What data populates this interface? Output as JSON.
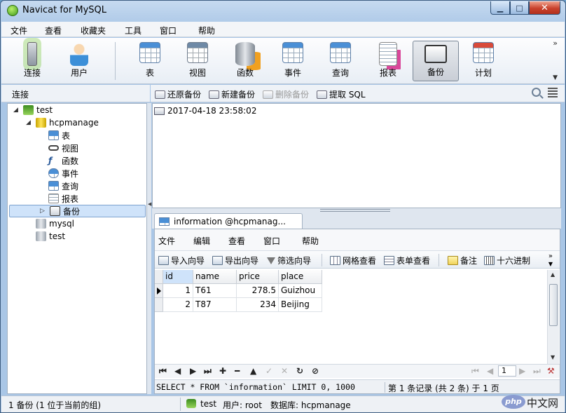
{
  "window": {
    "title": "Navicat for MySQL",
    "min_glyph": "▁",
    "max_glyph": "□",
    "close_glyph": "✕"
  },
  "menu": [
    "文件",
    "查看",
    "收藏夹",
    "工具",
    "窗口",
    "帮助"
  ],
  "toolbar": {
    "buttons": [
      "连接",
      "用户",
      "表",
      "视图",
      "函数",
      "事件",
      "查询",
      "报表",
      "备份",
      "计划"
    ],
    "active": "备份",
    "overflow_glyph": "»",
    "down_glyph": "▼"
  },
  "connection_header": "连接",
  "object_toolbar": {
    "restore": "还原备份",
    "new": "新建备份",
    "delete": "删除备份",
    "extract": "提取 SQL"
  },
  "tree": {
    "root": "test",
    "db_open": "hcpmanage",
    "children": [
      "表",
      "视图",
      "函数",
      "事件",
      "查询",
      "报表",
      "备份"
    ],
    "other_dbs": [
      "mysql",
      "test"
    ],
    "expand_open": "◢",
    "expand_closed": "▷"
  },
  "backup_list": {
    "items": [
      "2017-04-18 23:58:02"
    ]
  },
  "tab": {
    "label": "information @hcpmanag..."
  },
  "sub_menu": [
    "文件",
    "编辑",
    "查看",
    "窗口",
    "帮助"
  ],
  "sub_toolbar": {
    "import": "导入向导",
    "export": "导出向导",
    "filter": "筛选向导",
    "grid_view": "网格查看",
    "form_view": "表单查看",
    "memo": "备注",
    "hex": "十六进制",
    "more_glyph": "»",
    "down_glyph": "▼"
  },
  "table": {
    "columns": [
      "id",
      "name",
      "price",
      "place"
    ],
    "rows": [
      [
        "1",
        "T61",
        "278.5",
        "Guizhou"
      ],
      [
        "2",
        "T87",
        "234",
        "Beijing"
      ]
    ]
  },
  "navbar": {
    "first": "⏮",
    "prev": "◀",
    "next": "▶",
    "last": "⏭",
    "add": "✚",
    "remove": "━",
    "up": "▲",
    "apply": "✓",
    "cancel": "✕",
    "refresh": "↻",
    "stop": "⊘",
    "page_first": "⏮",
    "page_prev": "◀",
    "page": "1",
    "page_next": "▶",
    "page_last": "⏭",
    "settings": "⚒"
  },
  "sql": {
    "text": "SELECT * FROM `information` LIMIT 0, 1000",
    "record": "第 1 条记录 (共 2 条) 于 1 页"
  },
  "status": {
    "left": "1 备份 (1 位于当前的组)",
    "connection": "test",
    "user": "用户: root",
    "database": "数据库: hcpmanage"
  },
  "watermark": {
    "oval": "php",
    "text": "中文网"
  },
  "colors": {
    "accent": "#4a8fd6",
    "selection": "#cfe3fa"
  }
}
